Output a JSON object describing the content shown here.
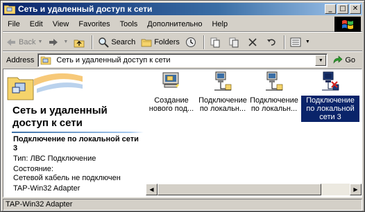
{
  "window": {
    "title": "Сеть и удаленный доступ к сети",
    "min_glyph": "_",
    "max_glyph": "□",
    "close_glyph": "✕"
  },
  "menu": [
    "File",
    "Edit",
    "View",
    "Favorites",
    "Tools",
    "Дополнительно",
    "Help"
  ],
  "toolbar": {
    "back_label": "Back",
    "search_label": "Search",
    "folders_label": "Folders"
  },
  "address": {
    "label": "Address",
    "value": "Сеть и удаленный доступ к сети",
    "go_label": "Go"
  },
  "left_pane": {
    "title": "Сеть и удаленный доступ к сети",
    "selected_name": "Подключение по локальной сети 3",
    "type_line": "Тип: ЛВС Подключение",
    "state_label": "Состояние:",
    "state_value": "Сетевой кабель не подключен",
    "adapter": "TAP-Win32 Adapter"
  },
  "items": [
    {
      "label": "Создание нового под...",
      "icon": "new-connection-icon",
      "selected": false
    },
    {
      "label": "Подключение по локальн...",
      "icon": "lan-connection-icon",
      "selected": false
    },
    {
      "label": "Подключение по локальн...",
      "icon": "lan-connection-icon",
      "selected": false
    },
    {
      "label": "Подключение по локальной сети 3",
      "icon": "lan-disconnected-icon",
      "selected": true
    }
  ],
  "status": {
    "text": "TAP-Win32 Adapter"
  },
  "colors": {
    "title_gradient_start": "#0a246a",
    "title_gradient_end": "#a6caf0",
    "face": "#d4d0c8",
    "selection": "#0a246a"
  }
}
